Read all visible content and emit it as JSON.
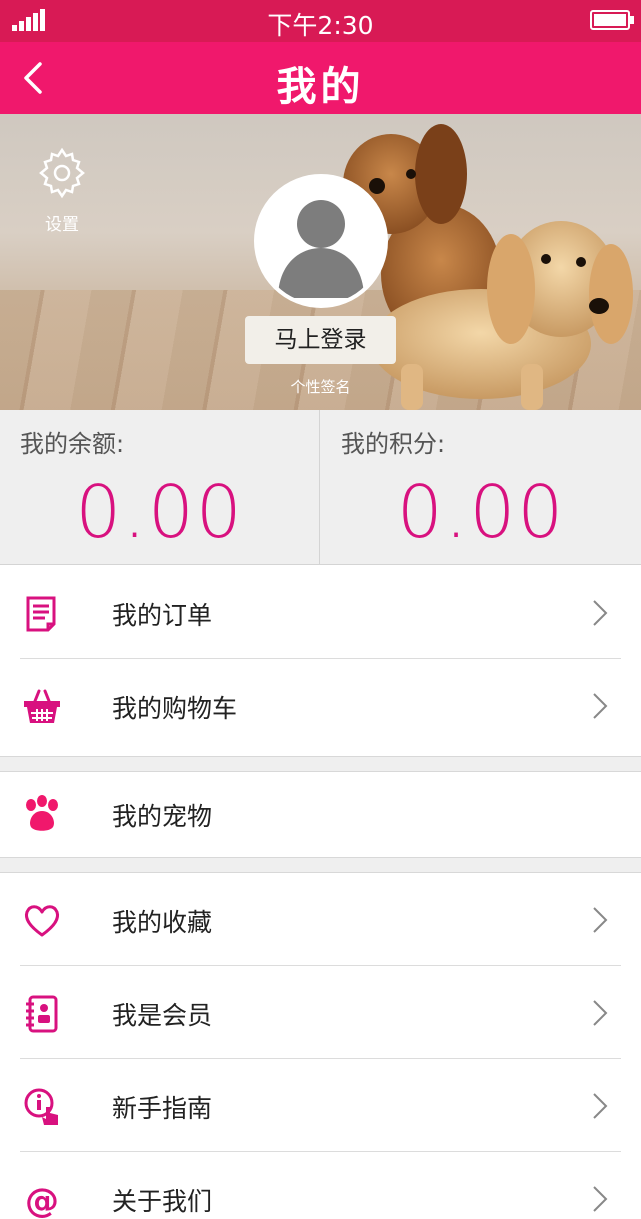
{
  "status_bar": {
    "time": "下午2:30"
  },
  "nav": {
    "title": "我的",
    "back_icon": "chevron-left-icon"
  },
  "hero": {
    "settings_label": "设置",
    "login_label": "马上登录",
    "signature": "个性签名"
  },
  "stats": {
    "balance_label": "我的余额:",
    "balance_value": "0.00",
    "points_label": "我的积分:",
    "points_value": "0.00"
  },
  "menu": {
    "orders": "我的订单",
    "cart": "我的购物车",
    "pets": "我的宠物",
    "favorites": "我的收藏",
    "member": "我是会员",
    "guide": "新手指南",
    "about": "关于我们"
  },
  "colors": {
    "status_bar": "#d81a55",
    "nav_bar": "#f0186c",
    "accent": "#d8117f"
  }
}
